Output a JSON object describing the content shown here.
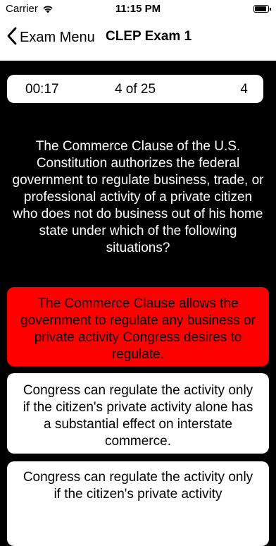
{
  "status_bar": {
    "carrier": "Carrier",
    "time": "11:15 PM",
    "wifi_icon": "wifi-icon",
    "battery_icon": "battery-icon"
  },
  "nav": {
    "back_label": "Exam Menu",
    "back_icon": "chevron-left-icon",
    "title": "CLEP Exam 1"
  },
  "info_bar": {
    "timer": "00:17",
    "progress": "4 of 25",
    "score": "4"
  },
  "question": "The Commerce Clause of the U.S. Constitution authorizes the federal government to regulate business, trade, or professional activity of a private citizen who does not do business out of his home state under which of the following situations?",
  "answers": [
    {
      "text": "The Commerce Clause allows the government to regulate any business or private activity Congress desires to regulate.",
      "state": "incorrect",
      "color": "#ff0000"
    },
    {
      "text": "Congress can regulate the activity only if the citizen's private activity alone has a substantial effect on interstate commerce.",
      "state": "default",
      "color": "#ffffff"
    },
    {
      "text": "Congress can regulate the activity only if the citizen's private activity",
      "state": "default",
      "color": "#ffffff"
    }
  ],
  "colors": {
    "background": "#000000",
    "panel": "#ffffff",
    "incorrect": "#ff0000"
  }
}
